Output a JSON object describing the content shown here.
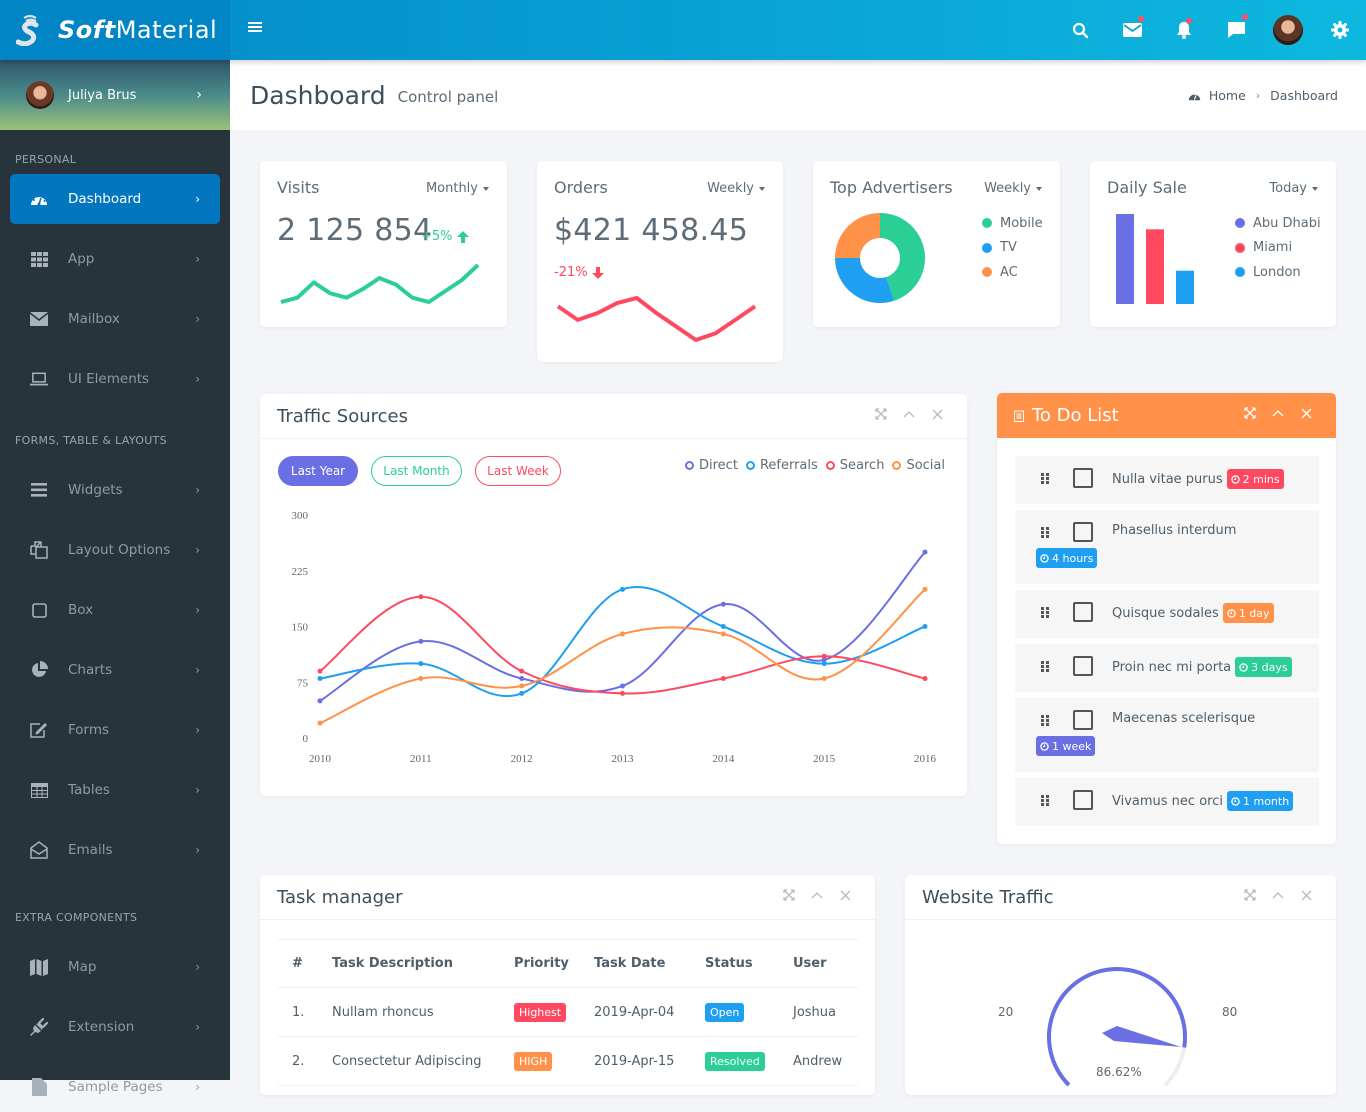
{
  "app": {
    "brand_bold": "Soft",
    "brand_light": "Material"
  },
  "header": {
    "icons": [
      {
        "name": "search-icon",
        "badge": false
      },
      {
        "name": "mail-icon",
        "badge": true
      },
      {
        "name": "bell-icon",
        "badge": true
      },
      {
        "name": "chat-icon",
        "badge": true
      },
      {
        "name": "user-avatar",
        "badge": false
      },
      {
        "name": "gear-icon",
        "badge": false
      }
    ]
  },
  "sidebar": {
    "user_name": "Juliya Brus",
    "sections": [
      {
        "header": "PERSONAL",
        "items": [
          {
            "label": "Dashboard",
            "icon": "dashboard-icon",
            "active": true
          },
          {
            "label": "App",
            "icon": "apps-grid-icon"
          },
          {
            "label": "Mailbox",
            "icon": "envelope-icon"
          },
          {
            "label": "UI Elements",
            "icon": "laptop-icon"
          }
        ]
      },
      {
        "header": "FORMS, TABLE & LAYOUTS",
        "items": [
          {
            "label": "Widgets",
            "icon": "bars-icon"
          },
          {
            "label": "Layout Options",
            "icon": "copy-icon"
          },
          {
            "label": "Box",
            "icon": "square-icon"
          },
          {
            "label": "Charts",
            "icon": "pie-chart-icon"
          },
          {
            "label": "Forms",
            "icon": "edit-icon"
          },
          {
            "label": "Tables",
            "icon": "table-icon"
          },
          {
            "label": "Emails",
            "icon": "envelope-open-icon"
          }
        ]
      },
      {
        "header": "EXTRA COMPONENTS",
        "items": [
          {
            "label": "Map",
            "icon": "map-icon"
          },
          {
            "label": "Extension",
            "icon": "plug-icon"
          },
          {
            "label": "Sample Pages",
            "icon": "file-icon"
          }
        ]
      }
    ]
  },
  "page": {
    "title": "Dashboard",
    "subtitle": "Control panel",
    "breadcrumb": [
      "Home",
      "Dashboard"
    ]
  },
  "stats": {
    "visits": {
      "title": "Visits",
      "period": "Monthly",
      "value": "2 125 854",
      "change": "+5%",
      "trend": "up",
      "spark": [
        10,
        14,
        28,
        18,
        14,
        22,
        32,
        26,
        14,
        10,
        20,
        30,
        44
      ]
    },
    "orders": {
      "title": "Orders",
      "period": "Weekly",
      "value": "$421 458.45",
      "change": "-21%",
      "trend": "down",
      "spark": [
        30,
        22,
        26,
        32,
        35,
        26,
        18,
        10,
        14,
        22,
        30
      ]
    },
    "advertisers": {
      "title": "Top Advertisers",
      "period": "Weekly",
      "legend": [
        {
          "label": "Mobile",
          "value": 45,
          "color": "#2bcf95"
        },
        {
          "label": "TV",
          "value": 30,
          "color": "#1e9ff2"
        },
        {
          "label": "AC",
          "value": 25,
          "color": "#ff9149"
        }
      ]
    },
    "daily_sale": {
      "title": "Daily Sale",
      "period": "Today",
      "legend": [
        {
          "label": "Abu Dhabi",
          "value": 100,
          "color": "#6a6fe4"
        },
        {
          "label": "Miami",
          "value": 83,
          "color": "#ff4961"
        },
        {
          "label": "London",
          "value": 37,
          "color": "#1e9ff2"
        }
      ]
    }
  },
  "traffic": {
    "title": "Traffic Sources",
    "filters": [
      "Last Year",
      "Last Month",
      "Last Week"
    ],
    "active_filter": "Last Year"
  },
  "chart_data": {
    "type": "line",
    "title": "Traffic Sources",
    "x": [
      "2010",
      "2011",
      "2012",
      "2013",
      "2014",
      "2015",
      "2016"
    ],
    "yticks": [
      "0",
      "75",
      "150",
      "225",
      "300"
    ],
    "ylim": [
      0,
      300
    ],
    "legend_position": "top-right",
    "series": [
      {
        "name": "Direct",
        "color": "#6a6fe4",
        "values": [
          50,
          130,
          80,
          70,
          180,
          105,
          250
        ]
      },
      {
        "name": "Referrals",
        "color": "#1e9ff2",
        "values": [
          80,
          100,
          60,
          200,
          150,
          100,
          150
        ]
      },
      {
        "name": "Search",
        "color": "#ff4961",
        "values": [
          90,
          190,
          90,
          60,
          80,
          110,
          80
        ]
      },
      {
        "name": "Social",
        "color": "#ff9149",
        "values": [
          20,
          80,
          70,
          140,
          140,
          80,
          200
        ]
      }
    ]
  },
  "todo": {
    "title": "To Do List",
    "items": [
      {
        "text": "Nulla vitae purus",
        "badge": "2 mins",
        "color": "#ff4961",
        "wrap": false
      },
      {
        "text": "Phasellus interdum",
        "badge": "4 hours",
        "color": "#1e9ff2",
        "wrap": true
      },
      {
        "text": "Quisque sodales",
        "badge": "1 day",
        "color": "#ff9149",
        "wrap": false
      },
      {
        "text": "Proin nec mi porta",
        "badge": "3 days",
        "color": "#2bcf95",
        "wrap": false
      },
      {
        "text": "Maecenas scelerisque",
        "badge": "1 week",
        "color": "#6a6fe4",
        "wrap": true
      },
      {
        "text": "Vivamus nec orci",
        "badge": "1 month",
        "color": "#1e9ff2",
        "wrap": false
      }
    ]
  },
  "tasks": {
    "title": "Task manager",
    "columns": [
      "#",
      "Task Description",
      "Priority",
      "Task Date",
      "Status",
      "User"
    ],
    "rows": [
      {
        "num": "1.",
        "desc": "Nullam rhoncus",
        "priority": "Highest",
        "priority_color": "#ff4961",
        "date": "2019-Apr-04",
        "status": "Open",
        "status_color": "#1e9ff2",
        "user": "Joshua"
      },
      {
        "num": "2.",
        "desc": "Consectetur Adipiscing",
        "priority": "HIGH",
        "priority_color": "#ff9149",
        "date": "2019-Apr-15",
        "status": "Resolved",
        "status_color": "#2bcf95",
        "user": "Andrew"
      }
    ]
  },
  "website_traffic": {
    "title": "Website Traffic",
    "label_left": "20",
    "label_right": "80",
    "value": "86.62%",
    "percent": 86.62
  }
}
